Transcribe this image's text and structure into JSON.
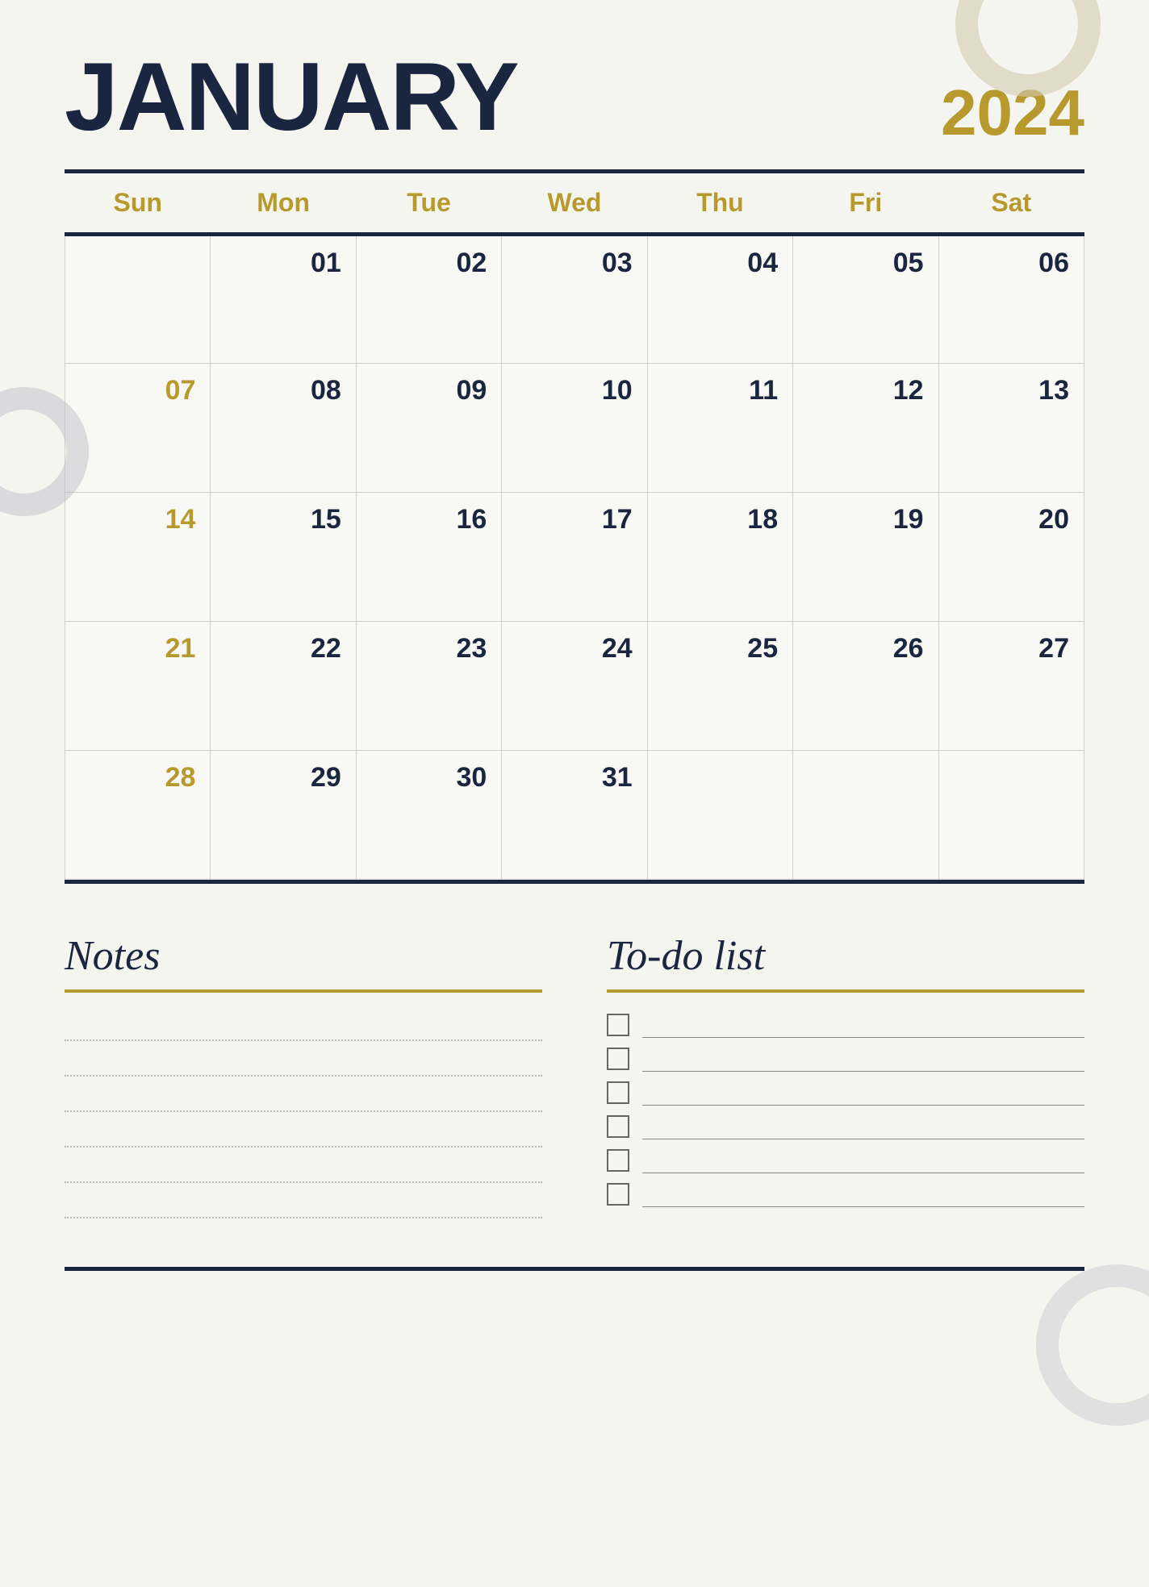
{
  "header": {
    "month": "JANUARY",
    "year": "2024"
  },
  "colors": {
    "primary": "#1a2540",
    "accent": "#b8992e",
    "bg": "#f5f5f0",
    "cell_bg": "#f8f8f4",
    "border": "#d0cfc8"
  },
  "calendar": {
    "days_of_week": [
      "Sun",
      "Mon",
      "Tue",
      "Wed",
      "Thu",
      "Fri",
      "Sat"
    ],
    "weeks": [
      [
        null,
        "01",
        "02",
        "03",
        "04",
        "05",
        "06"
      ],
      [
        "07",
        "08",
        "09",
        "10",
        "11",
        "12",
        "13"
      ],
      [
        "14",
        "15",
        "16",
        "17",
        "18",
        "19",
        "20"
      ],
      [
        "21",
        "22",
        "23",
        "24",
        "25",
        "26",
        "27"
      ],
      [
        "28",
        "29",
        "30",
        "31",
        null,
        null,
        null
      ]
    ],
    "sunday_dates": [
      "07",
      "14",
      "21",
      "28"
    ]
  },
  "notes": {
    "title": "Notes",
    "lines": 6
  },
  "todo": {
    "title": "To-do list",
    "items": 6
  }
}
